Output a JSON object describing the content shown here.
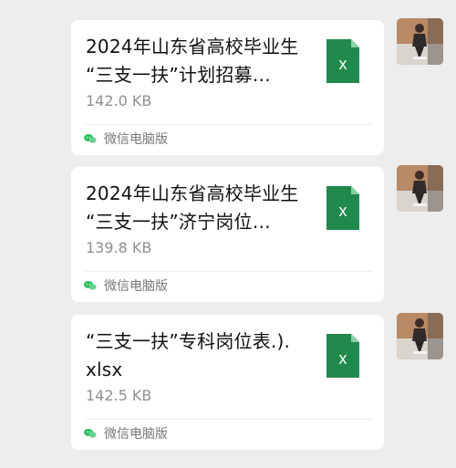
{
  "messages": [
    {
      "file_name": "2024年山东省高校毕业生\n“三支一扶”计划招募…",
      "file_size": "142.0 KB",
      "source": "微信电脑版",
      "file_icon": "x"
    },
    {
      "file_name": "2024年山东省高校毕业生\n“三支一扶”济宁岗位…",
      "file_size": "139.8 KB",
      "source": "微信电脑版",
      "file_icon": "x"
    },
    {
      "file_name": "“三支一扶”专科岗位表.).\nxlsx",
      "file_size": "142.5 KB",
      "source": "微信电脑版",
      "file_icon": "x"
    }
  ],
  "colors": {
    "background": "#ededed",
    "card": "#ffffff",
    "excel_green": "#1f8a4c",
    "wechat_green": "#2dc163"
  },
  "icons": {
    "file_type": "excel-file-icon",
    "source": "wechat-icon",
    "user": "avatar"
  }
}
